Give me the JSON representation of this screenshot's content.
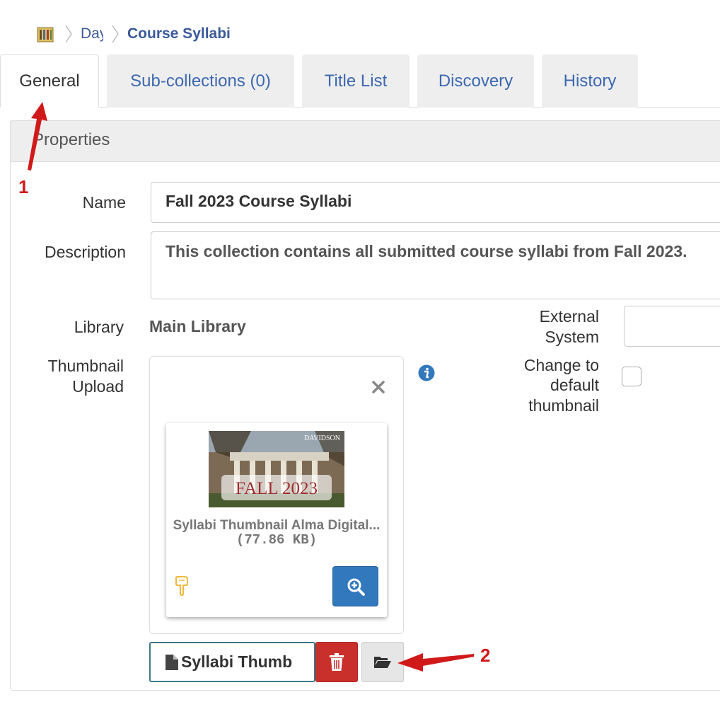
{
  "breadcrumb": {
    "home_icon": "library-icon",
    "items": [
      "Day",
      "Course Syllabi"
    ]
  },
  "tabs": [
    {
      "label": "General",
      "active": true
    },
    {
      "label": "Sub-collections (0)",
      "active": false
    },
    {
      "label": "Title List",
      "active": false
    },
    {
      "label": "Discovery",
      "active": false
    },
    {
      "label": "History",
      "active": false
    }
  ],
  "panel": {
    "title": "Properties"
  },
  "form": {
    "name_label": "Name",
    "name_value": "Fall 2023 Course Syllabi",
    "description_label": "Description",
    "description_value": "This collection contains all submitted course syllabi from Fall 2023.",
    "library_label": "Library",
    "library_value": "Main Library",
    "external_system_label_1": "External",
    "external_system_label_2": "System",
    "external_system_value": "",
    "thumbnail_label_1": "Thumbnail",
    "thumbnail_label_2": "Upload",
    "change_default_label_1": "Change to",
    "change_default_label_2": "default",
    "change_default_label_3": "thumbnail",
    "change_default_checked": false
  },
  "thumbnail": {
    "image_badge": "DAVIDSON",
    "image_caption": "FALL 2023",
    "file_name": "Syllabi Thumbnail Alma Digital...",
    "file_size": "(77.86 KB)",
    "upload_field_value": "Syllabi Thumb"
  },
  "annotations": {
    "one": "1",
    "two": "2"
  },
  "colors": {
    "link": "#3d68b0",
    "primary_button": "#3278bd",
    "danger_button": "#c9302c",
    "annotation": "#d01a1a"
  }
}
